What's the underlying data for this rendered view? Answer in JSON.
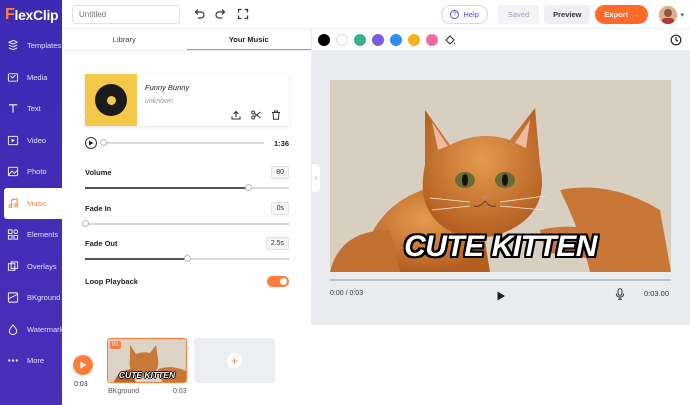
{
  "logo": {
    "first": "F",
    "rest": "lexClip"
  },
  "sidebar": {
    "items": [
      {
        "label": "Templates",
        "icon": "templates-icon"
      },
      {
        "label": "Media",
        "icon": "media-icon"
      },
      {
        "label": "Text",
        "icon": "text-icon"
      },
      {
        "label": "Video",
        "icon": "video-icon"
      },
      {
        "label": "Photo",
        "icon": "photo-icon"
      },
      {
        "label": "Music",
        "icon": "music-icon",
        "active": true
      },
      {
        "label": "Elements",
        "icon": "elements-icon"
      },
      {
        "label": "Overlays",
        "icon": "overlays-icon"
      },
      {
        "label": "BKground",
        "icon": "background-icon"
      },
      {
        "label": "Watermark",
        "icon": "watermark-icon"
      },
      {
        "label": "More",
        "icon": "more-icon"
      }
    ]
  },
  "topbar": {
    "title_placeholder": "Untitled",
    "help_label": "Help",
    "saved_label": "Saved",
    "preview_label": "Preview",
    "export_label": "Export",
    "export_arrow": "→"
  },
  "panel": {
    "tabs": [
      {
        "label": "Library"
      },
      {
        "label": "Your Music",
        "active": true
      }
    ],
    "music": {
      "name": "Funny Bunny",
      "artist": "unknown"
    },
    "player": {
      "duration": "1:36",
      "progress": 0
    },
    "volume": {
      "label": "Volume",
      "value": "80",
      "fraction": 0.8
    },
    "fade_in": {
      "label": "Fade In",
      "value": "0s",
      "fraction": 0
    },
    "fade_out": {
      "label": "Fade Out",
      "value": "2.5s",
      "fraction": 0.5
    },
    "loop": {
      "label": "Loop Playback",
      "on": true
    }
  },
  "colorbar": {
    "swatches": [
      "#000000",
      "#ffffff",
      "#3bb08f",
      "#7b5ce0",
      "#2f8ff0",
      "#f4b31c",
      "#f06aa0"
    ]
  },
  "stage": {
    "caption": "CUTE KITTEN",
    "current_time": "0:00 / 0:03",
    "end_time": "0:03.00"
  },
  "timeline": {
    "play_time": "0:03",
    "clip": {
      "number": "01",
      "caption": "CUTE KITTEN",
      "name": "BKground",
      "duration": "0:03"
    },
    "add_label": "+"
  },
  "colors": {
    "accent": "#ff7d3a",
    "sidebar": "#3c2ab5"
  }
}
